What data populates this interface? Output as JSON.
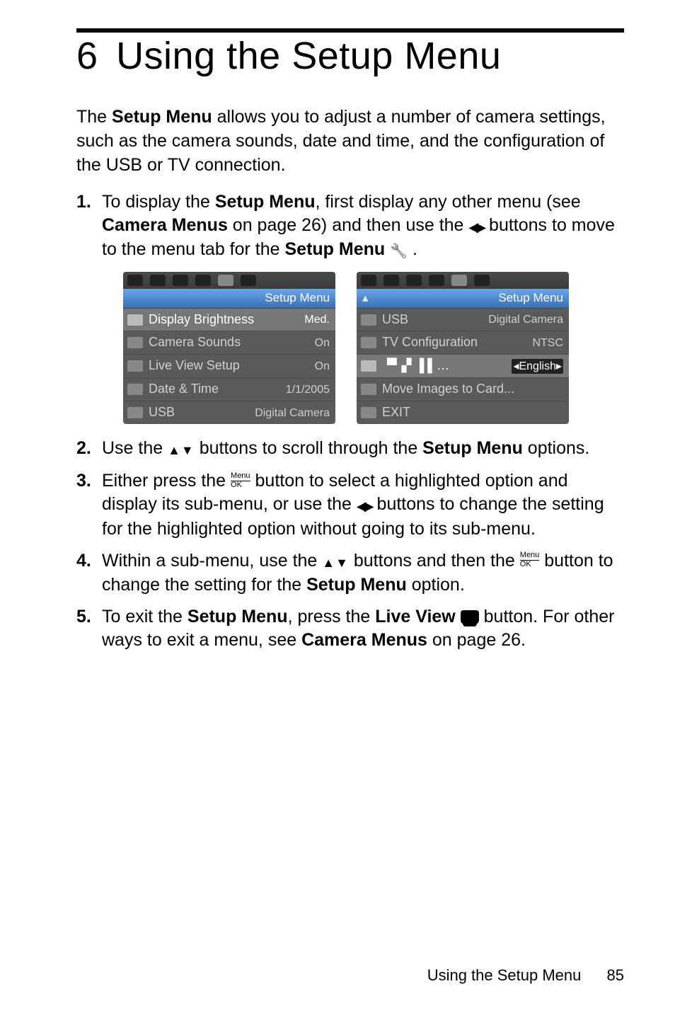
{
  "chapter": {
    "number": "6",
    "title": "Using the Setup Menu"
  },
  "intro": {
    "pre": "The ",
    "b1": "Setup Menu",
    "post": " allows you to adjust a number of camera settings, such as the camera sounds, date and time, and the configuration of the USB or TV connection."
  },
  "steps": {
    "1": {
      "num": "1.",
      "t1": "To display the ",
      "b1": "Setup Menu",
      "t2": ", first display any other menu (see ",
      "b2": "Camera Menus",
      "t3": " on page 26) and then use the ",
      "t4": " buttons to move to the menu tab for the ",
      "b3": "Setup Menu",
      "t5": " ."
    },
    "2": {
      "num": "2.",
      "t1": "Use the ",
      "t2": " buttons to scroll through the ",
      "b1": "Setup Menu",
      "t3": " options."
    },
    "3": {
      "num": "3.",
      "t1": "Either press the ",
      "t2": " button to select a highlighted option and display its sub-menu, or use the ",
      "t3": " buttons to change the setting for the highlighted option without going to its sub-menu."
    },
    "4": {
      "num": "4.",
      "t1": "Within a sub-menu, use the ",
      "t2": " buttons and then the ",
      "t3": " button to change the setting for the ",
      "b1": "Setup Menu",
      "t4": " option."
    },
    "5": {
      "num": "5.",
      "t1": "To exit the ",
      "b1": "Setup Menu",
      "t2": ", press the ",
      "b2": "Live View",
      "t3": " button. For other ways to exit a menu, see ",
      "b3": "Camera Menus",
      "t4": " on page 26."
    }
  },
  "screenA": {
    "banner": "Setup Menu",
    "rows": [
      {
        "label": "Display Brightness",
        "val": "Med."
      },
      {
        "label": "Camera Sounds",
        "val": "On"
      },
      {
        "label": "Live View Setup",
        "val": "On"
      },
      {
        "label": "Date & Time",
        "val": "1/1/2005"
      },
      {
        "label": "USB",
        "val": "Digital Camera"
      }
    ]
  },
  "screenB": {
    "banner": "Setup Menu",
    "rows": [
      {
        "label": "USB",
        "val": "Digital Camera"
      },
      {
        "label": "TV Configuration",
        "val": "NTSC"
      },
      {
        "label": "▝▘▞ ▐ ▌…",
        "val": "◂English▸"
      },
      {
        "label": "Move Images to Card...",
        "val": ""
      },
      {
        "label": "EXIT",
        "val": ""
      }
    ]
  },
  "menuok": {
    "top": "Menu",
    "bottom": "OK"
  },
  "footer": {
    "text": "Using the Setup Menu",
    "page": "85"
  }
}
